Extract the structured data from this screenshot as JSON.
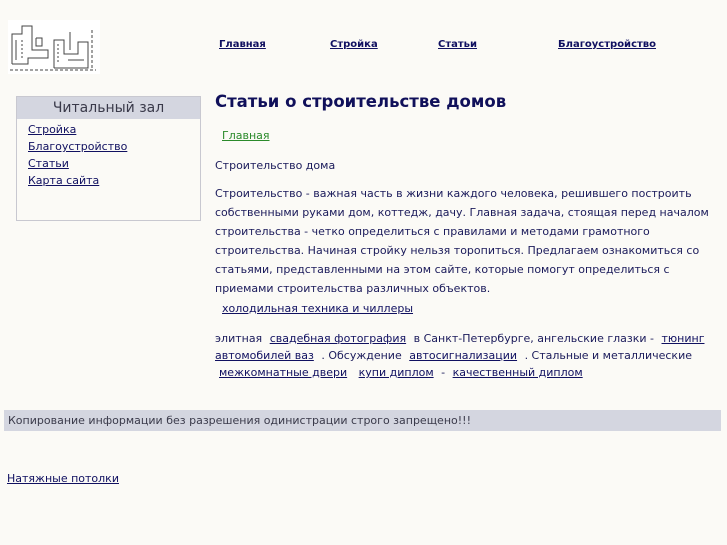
{
  "nav": {
    "home": "Главная",
    "build": "Стройка",
    "articles": "Статьи",
    "landscaping": "Благоустройство"
  },
  "sidebar": {
    "title": "Читальный зал",
    "items": [
      {
        "label": "Стройка"
      },
      {
        "label": "Благоустройство"
      },
      {
        "label": "Статьи"
      },
      {
        "label": "Карта сайта"
      }
    ]
  },
  "main": {
    "title": "Статьи о строительстве домов",
    "breadcrumb": "Главная",
    "subtitle": "Строительство дома",
    "intro": "Строительство - важная часть в жизни каждого человека, решившего построить собственными руками дом, коттедж, дачу. Главная задача, стоящая перед началом строительства - четко определиться с правилами и методами грамотного строительства. Начиная стройку нельзя торопиться. Предлагаем ознакомиться со статьями, представленными на этом сайте, которые помогут определиться с приемами строительства различных объектов.",
    "cooling_link": "холодильная техника и чиллеры"
  },
  "links": {
    "t1": "элитная",
    "a1": "свадебная фотография",
    "t2": "в Санкт-Петербурге, ангельские глазки -",
    "a2": "тюнинг автомобилей ваз",
    "t3": ". Обсуждение",
    "a3": "автосигнализации",
    "t4": ". Стальные и металлические",
    "a4": "межкомнатные двери",
    "a5": "купи диплом",
    "t5": "-",
    "a6": "качественный диплом"
  },
  "footer": {
    "notice": "Копирование информации без разрешения одинистрации строго запрещено!!!",
    "ceiling_link": "Натяжные потолки"
  }
}
